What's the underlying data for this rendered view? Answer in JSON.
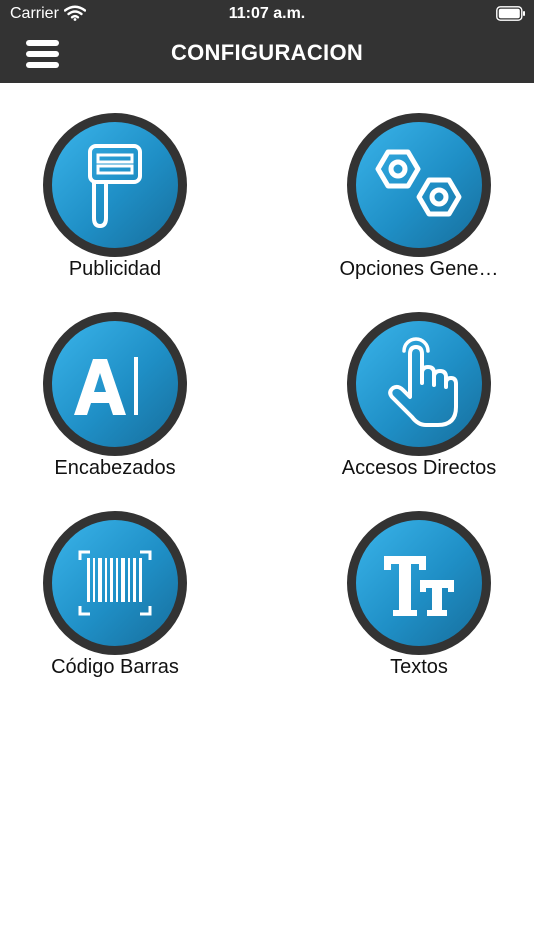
{
  "status_bar": {
    "carrier": "Carrier",
    "time": "11:07 a.m."
  },
  "header": {
    "title": "CONFIGURACION"
  },
  "menu": {
    "items": [
      {
        "label": "Publicidad",
        "icon": "scale-display-icon"
      },
      {
        "label": "Opciones Gene…",
        "icon": "nuts-icon"
      },
      {
        "label": "Encabezados",
        "icon": "text-cursor-icon"
      },
      {
        "label": "Accesos Directos",
        "icon": "touch-hand-icon"
      },
      {
        "label": "Código Barras",
        "icon": "barcode-icon"
      },
      {
        "label": "Textos",
        "icon": "text-size-icon"
      }
    ]
  },
  "colors": {
    "header_bg": "#333333",
    "icon_gradient_start": "#3ab4ea",
    "icon_gradient_end": "#176e9c",
    "icon_ring": "#333333"
  }
}
